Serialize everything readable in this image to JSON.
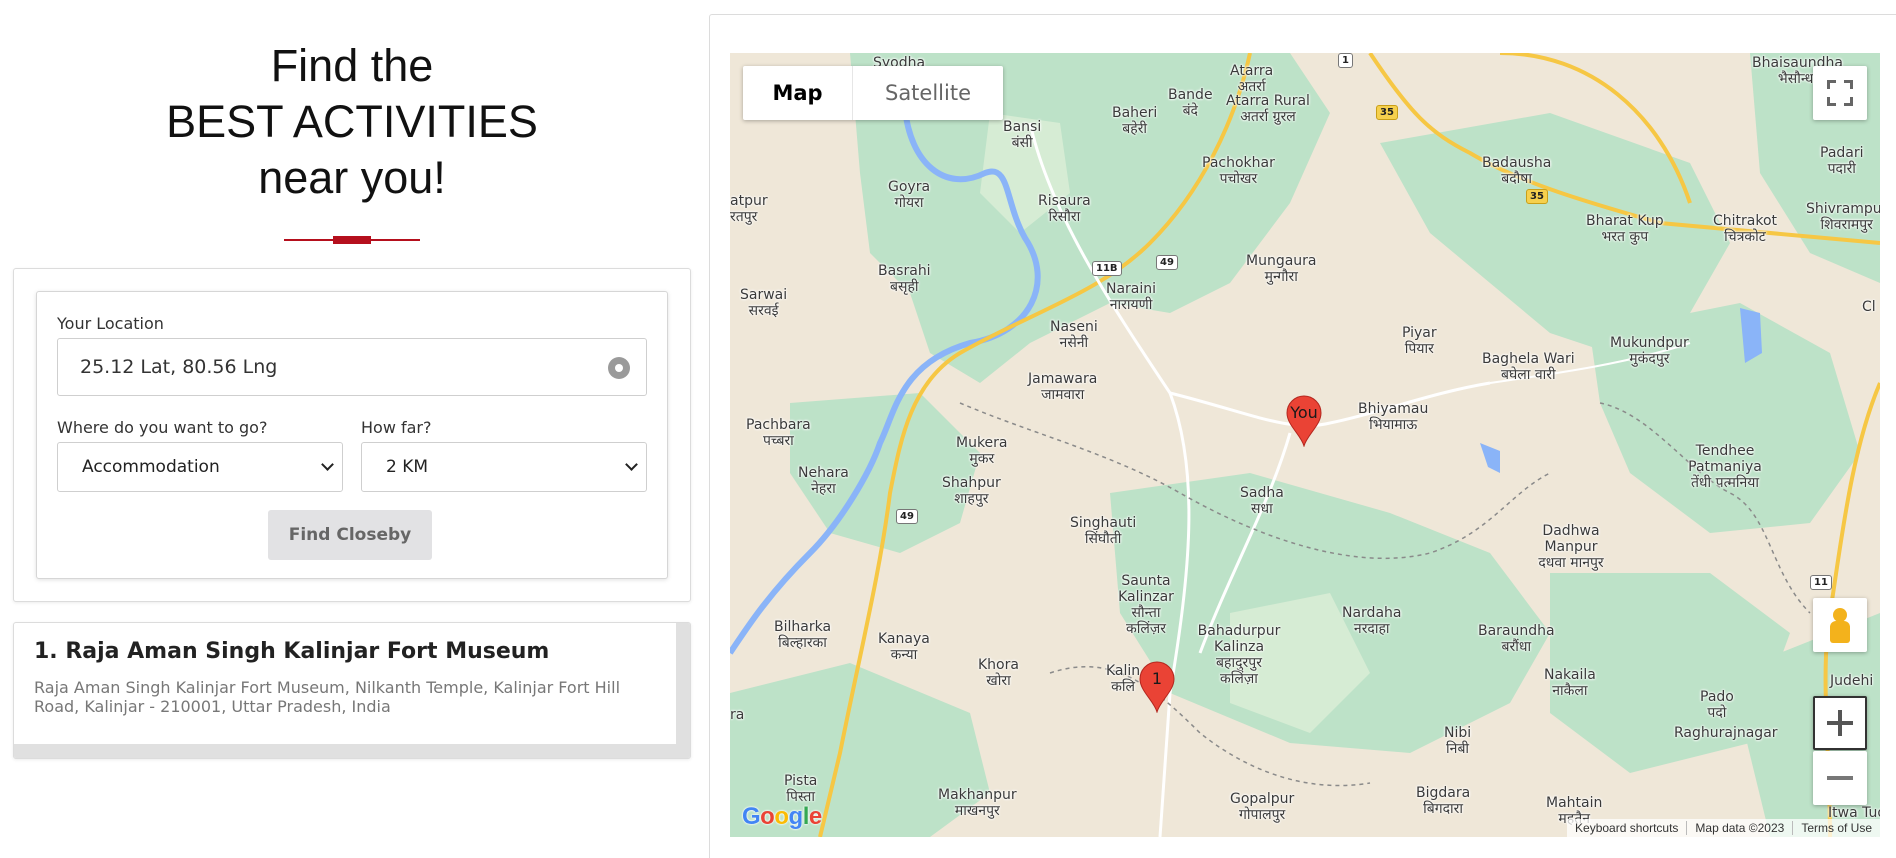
{
  "hero": {
    "line1": "Find the",
    "line2": "BEST ACTIVITIES",
    "line3": "near you!"
  },
  "form": {
    "location_label": "Your Location",
    "location_value": "25.12 Lat, 80.56 Lng",
    "destination_label": "Where do you want to go?",
    "destination_value": "Accommodation",
    "distance_label": "How far?",
    "distance_value": "2 KM",
    "submit_label": "Find Closeby"
  },
  "results": [
    {
      "title": "1. Raja Aman Singh Kalinjar Fort Museum",
      "address": "Raja Aman Singh Kalinjar Fort Museum, Nilkanth Temple, Kalinjar Fort Hill Road, Kalinjar - 210001, Uttar Pradesh, India"
    }
  ],
  "map": {
    "type_map_label": "Map",
    "type_satellite_label": "Satellite",
    "you_marker_label": "You",
    "result_marker_label": "1",
    "attribution": {
      "shortcuts": "Keyboard shortcuts",
      "data": "Map data ©2023",
      "terms": "Terms of Use"
    },
    "logo_text": "Google",
    "colors": {
      "marker": "#ea4335",
      "land": "#efe7d8",
      "forest": "#bde2c8",
      "water": "#8ab4f8",
      "highway": "#f6c744"
    },
    "highways": [
      "35",
      "35",
      "49",
      "49",
      "11",
      "11B",
      "1"
    ],
    "places": [
      {
        "name": "Syodha",
        "hi": ""
      },
      {
        "name": "Atarra",
        "hi": "अतर्रा"
      },
      {
        "name": "Bhaisaundha",
        "hi": "भैसौन्धा"
      },
      {
        "name": "Bande",
        "hi": "बंदे"
      },
      {
        "name": "Baheri",
        "hi": "बहेरी"
      },
      {
        "name": "Atarra Rural",
        "hi": "अतर्रा ग्रुरल"
      },
      {
        "name": "Bansi",
        "hi": "बंसी"
      },
      {
        "name": "Padari",
        "hi": "पदारी"
      },
      {
        "name": "Badausha",
        "hi": "बदौषा"
      },
      {
        "name": "Pachokhar",
        "hi": "पचोखर"
      },
      {
        "name": "Goyra",
        "hi": "गोयरा"
      },
      {
        "name": "Risaura",
        "hi": "रिसौरा"
      },
      {
        "name": "Shivrampur",
        "hi": "शिवरामपुर"
      },
      {
        "name": "atpur",
        "hi": "रतपुर"
      },
      {
        "name": "Bharat Kup",
        "hi": "भरत कुप"
      },
      {
        "name": "Chitrakot",
        "hi": "चित्रकोट"
      },
      {
        "name": "Mungaura",
        "hi": "मुन्गौरा"
      },
      {
        "name": "Basrahi",
        "hi": "बसृही"
      },
      {
        "name": "Naraini",
        "hi": "नारायणी"
      },
      {
        "name": "Sarwai",
        "hi": "सरवई"
      },
      {
        "name": "Naseni",
        "hi": "नसेनी"
      },
      {
        "name": "Piyar",
        "hi": "पियार"
      },
      {
        "name": "Baghela Wari",
        "hi": "बघेला वारी"
      },
      {
        "name": "Mukundpur",
        "hi": "मुकंदपुर"
      },
      {
        "name": "Jamawara",
        "hi": "जामवारा"
      },
      {
        "name": "Pachbara",
        "hi": "पच्बरा"
      },
      {
        "name": "Bhiyamau",
        "hi": "भियामाऊ"
      },
      {
        "name": "Mukera",
        "hi": "मुकर"
      },
      {
        "name": "Tendhee Patmaniya",
        "hi": "तेंधी पत्मनिया"
      },
      {
        "name": "Nehara",
        "hi": "नेहरा"
      },
      {
        "name": "Shahpur",
        "hi": "शाहपुर"
      },
      {
        "name": "Sadha",
        "hi": "सधा"
      },
      {
        "name": "Singhauti",
        "hi": "सिंघौती"
      },
      {
        "name": "Dadhwa Manpur",
        "hi": "दधवा मानपुर"
      },
      {
        "name": "Saunta Kalinzar",
        "hi": "सौन्ता कलिंज़र"
      },
      {
        "name": "Nardaha",
        "hi": "नरदाहा"
      },
      {
        "name": "Bilharka",
        "hi": "बिल्हारका"
      },
      {
        "name": "Bahadurpur Kalinza",
        "hi": "बहादुरपुर कलिंज़ा"
      },
      {
        "name": "Baraundha",
        "hi": "बरौंधा"
      },
      {
        "name": "Kanaya",
        "hi": "कन्या"
      },
      {
        "name": "Khora",
        "hi": "खोरा"
      },
      {
        "name": "Kalin",
        "hi": "कलि"
      },
      {
        "name": "Nakaila",
        "hi": "नाकैला"
      },
      {
        "name": "Judehi",
        "hi": ""
      },
      {
        "name": "Pado",
        "hi": "पदो"
      },
      {
        "name": "Raghurajnagar",
        "hi": ""
      },
      {
        "name": "Nibi",
        "hi": "निबी"
      },
      {
        "name": "Pista",
        "hi": "पिस्ता"
      },
      {
        "name": "Makhanpur",
        "hi": "माखनपुर"
      },
      {
        "name": "Gopalpur",
        "hi": "गोपालपुर"
      },
      {
        "name": "Bigdara",
        "hi": "बिगदारा"
      },
      {
        "name": "Mahtain",
        "hi": "महतैन"
      },
      {
        "name": "Itwa Tud",
        "hi": ""
      },
      {
        "name": "ra",
        "hi": ""
      },
      {
        "name": "Cl",
        "hi": ""
      }
    ]
  }
}
